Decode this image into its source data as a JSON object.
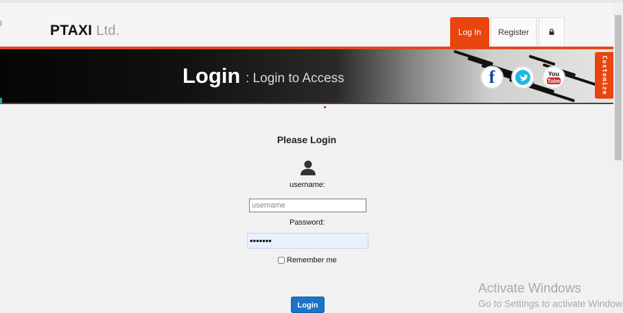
{
  "brand": {
    "name": "PTAXI",
    "suffix": "Ltd."
  },
  "nav": {
    "login": "Log In",
    "register": "Register",
    "lock_icon": "lock-icon"
  },
  "banner": {
    "title": "Login",
    "subtitle": ": Login to Access"
  },
  "social": {
    "facebook": "f",
    "facebook_icon": "facebook-icon",
    "twitter_icon": "twitter-icon",
    "youtube_icon": "youtube-icon",
    "youtube_top": "You",
    "youtube_bottom": "Tube"
  },
  "customize": "Customize",
  "form": {
    "heading": "Please Login",
    "username_label": "username:",
    "username_placeholder": "username",
    "username_value": "",
    "password_label": "Password:",
    "password_value": "•••••••",
    "remember_label": "Remember me",
    "submit_label": "Login"
  },
  "watermark": {
    "line1": "Activate Windows",
    "line2": "Go to Settings to activate Windows."
  },
  "colors": {
    "accent": "#e8450f",
    "primary_button": "#1a73c9"
  }
}
